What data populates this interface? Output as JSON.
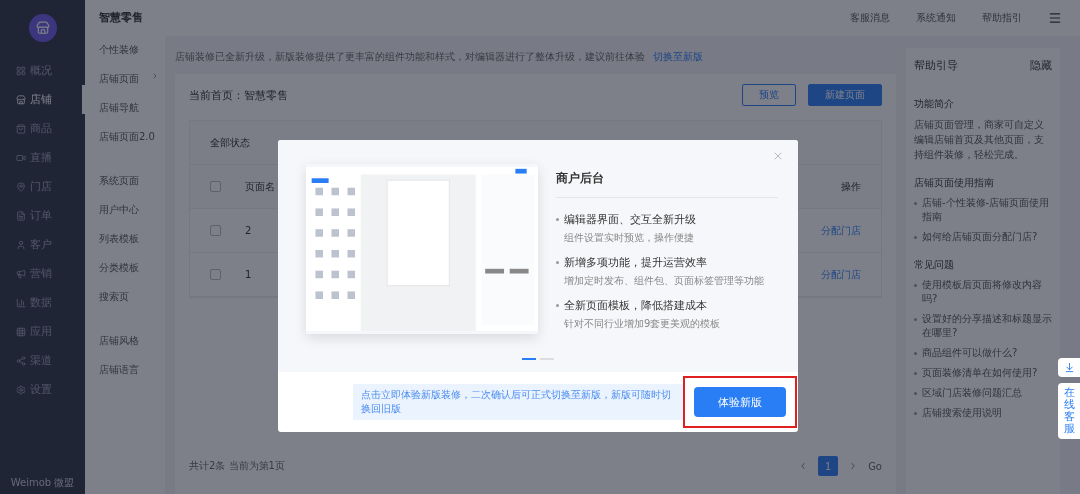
{
  "nav": {
    "items": [
      {
        "label": "概况",
        "selected": false
      },
      {
        "label": "店铺",
        "selected": true
      },
      {
        "label": "商品",
        "selected": false
      },
      {
        "label": "直播",
        "selected": false
      },
      {
        "label": "门店",
        "selected": false
      },
      {
        "label": "订单",
        "selected": false
      },
      {
        "label": "客户",
        "selected": false
      },
      {
        "label": "营销",
        "selected": false
      },
      {
        "label": "数据",
        "selected": false
      },
      {
        "label": "应用",
        "selected": false
      },
      {
        "label": "渠道",
        "selected": false
      },
      {
        "label": "设置",
        "selected": false
      }
    ],
    "footer": "Weimob 微盟"
  },
  "subnav": {
    "title": "智慧零售",
    "groups": [
      [
        {
          "label": "个性装修",
          "has_submenu": false
        },
        {
          "label": "店铺页面",
          "has_submenu": true
        },
        {
          "label": "店铺导航",
          "has_submenu": false
        },
        {
          "label": "店铺页面2.0",
          "has_submenu": false
        }
      ],
      [
        {
          "label": "系统页面",
          "has_submenu": false
        },
        {
          "label": "用户中心",
          "has_submenu": false
        },
        {
          "label": "列表模板",
          "has_submenu": false
        },
        {
          "label": "分类模板",
          "has_submenu": false
        },
        {
          "label": "搜索页",
          "has_submenu": false
        }
      ],
      [
        {
          "label": "店铺风格",
          "has_submenu": false
        },
        {
          "label": "店铺语言",
          "has_submenu": false
        }
      ]
    ]
  },
  "header": {
    "links": [
      "客服消息",
      "系统通知",
      "帮助指引"
    ]
  },
  "notice": {
    "text": "店铺装修已全新升级，新版装修提供了更丰富的组件功能和样式，对编辑器进行了整体升级，建议前往体验",
    "link": "切换至新版"
  },
  "home": {
    "label": "当前首页：智慧零售",
    "buttons": [
      {
        "label": "预览",
        "kind": "secondary"
      },
      {
        "label": "新建页面",
        "kind": "primary"
      }
    ]
  },
  "table": {
    "filter": "全部状态",
    "all_checked": false,
    "columns": [
      "页面名",
      "操作"
    ],
    "rows": [
      {
        "checked": false,
        "name": "2",
        "action": "分配门店"
      },
      {
        "checked": false,
        "name": "1",
        "action": "分配门店"
      }
    ]
  },
  "pagination": {
    "summary": "共计2条 当前为第1页",
    "pages": [
      {
        "label": "1",
        "selected": true
      }
    ],
    "go": "Go"
  },
  "help": {
    "title": "帮助引导",
    "hide": "隐藏",
    "sections": [
      {
        "title": "功能简介",
        "text": "店铺页面管理，商家可自定义编辑店铺首页及其他页面，支持组件装修，轻松完成。"
      },
      {
        "title": "店铺页面使用指南",
        "links": [
          "店铺-个性装修-店铺页面使用指南",
          "如何给店铺页面分配门店?"
        ]
      },
      {
        "title": "常见问题",
        "links": [
          "使用模板后页面将修改内容吗?",
          "设置好的分享描述和标题显示在哪里?",
          "商品组件可以做什么?",
          "页面装修清单在如何使用?",
          "区域门店装修问题汇总",
          "店铺搜索使用说明"
        ]
      }
    ]
  },
  "float": {
    "service": "在线客服"
  },
  "modal": {
    "title": "商户后台",
    "features": [
      {
        "title": "编辑器界面、交互全新升级",
        "text": "组件设置实时预览，操作便捷"
      },
      {
        "title": "新增多项功能，提升运营效率",
        "text": "增加定时发布、组件包、页面标签管理等功能"
      },
      {
        "title": "全新页面模板，降低搭建成本",
        "text": "针对不同行业增加9套更美观的模板"
      }
    ],
    "slides": [
      {
        "selected": true
      },
      {
        "selected": false
      }
    ],
    "tip": "点击立即体验新版装修，二次确认后可正式切换至新版，新版可随时切换回旧版",
    "button": "体验新版",
    "highlighted": true
  }
}
